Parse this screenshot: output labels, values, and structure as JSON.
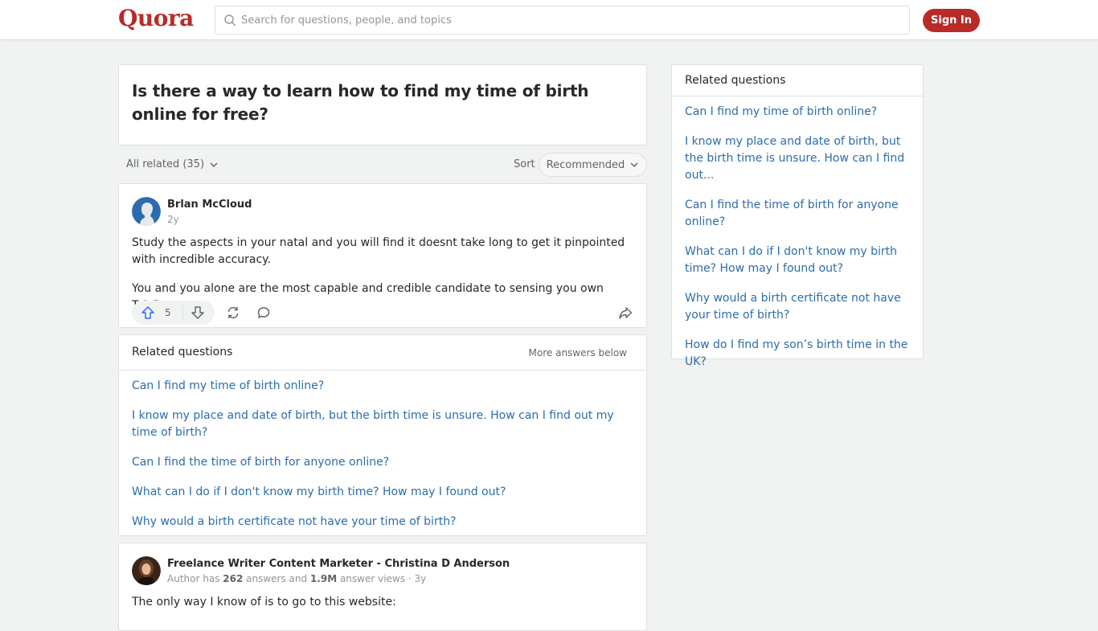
{
  "header": {
    "logo": "Quora",
    "search_placeholder": "Search for questions, people, and topics",
    "signin_label": "Sign In",
    "brand_color": "#b92b27"
  },
  "question": {
    "title": "Is there a way to learn how to find my time of birth online for free?"
  },
  "filter": {
    "all_related_label": "All related (35)",
    "sort_label": "Sort",
    "sort_value": "Recommended"
  },
  "answer1": {
    "author": "Brlan McCloud",
    "time": "2y",
    "paragraphs": [
      "Study the aspects in your natal and you will find it doesnt take long to get it pinpointed with incredible accuracy.",
      "You and you alone are the most capable and credible candidate to sensing you own T.O.B."
    ],
    "upvotes": "5",
    "icons": [
      "upvote-icon",
      "downvote-icon",
      "share-reshare-icon",
      "comment-icon",
      "share-icon"
    ]
  },
  "related_inline": {
    "title": "Related questions",
    "more_label": "More answers below",
    "items": [
      "Can I find my time of birth online?",
      "I know my place and date of birth, but the birth time is unsure. How can I find out my time of birth?",
      "Can I find the time of birth for anyone online?",
      "What can I do if I don't know my birth time? How may I found out?",
      "Why would a birth certificate not have your time of birth?"
    ]
  },
  "answer2": {
    "author": "Freelance Writer Content Marketer - Christina D Anderson",
    "meta_prefix": "Author has ",
    "answers_count": "262",
    "meta_mid": " answers and ",
    "views_count": "1.9M",
    "meta_suffix": " answer views · 3y",
    "text": "The only way I know of is to go to this website:"
  },
  "sidebar": {
    "title": "Related questions",
    "items": [
      "Can I find my time of birth online?",
      "I know my place and date of birth, but the birth time is unsure. How can I find out...",
      "Can I find the time of birth for anyone online?",
      "What can I do if I don't know my birth time? How may I found out?",
      "Why would a birth certificate not have your time of birth?",
      "How do I find my son’s birth time in the UK?"
    ]
  }
}
